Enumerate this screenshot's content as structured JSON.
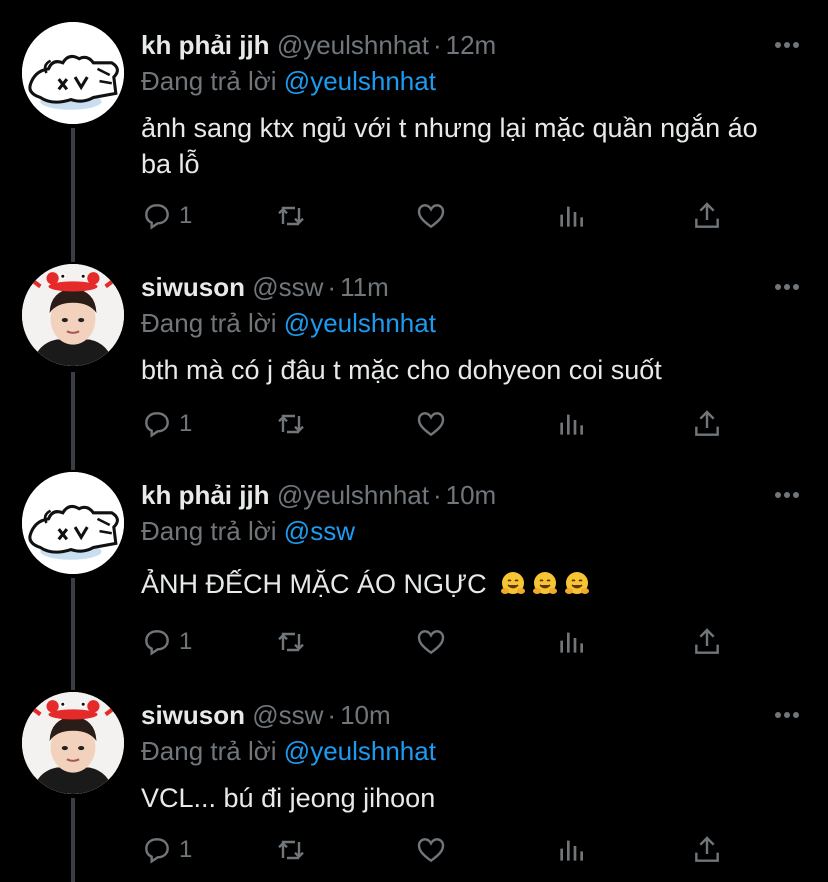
{
  "tweets": [
    {
      "display_name": "kh phải jjh",
      "handle": "@yeulshnhat",
      "time": "12m",
      "reply_prefix": "Đang trả lời",
      "reply_to": "@yeulshnhat",
      "text": "ảnh sang ktx ngủ với t nhưng lại mặc quần ngắn áo ba lỗ",
      "reply_count": "1",
      "avatar": "drawn-creature-avatar"
    },
    {
      "display_name": "siwuson",
      "handle": "@ssw",
      "time": "11m",
      "reply_prefix": "Đang trả lời",
      "reply_to": "@yeulshnhat",
      "text": "bth mà có j đâu t mặc cho dohyeon coi suốt",
      "reply_count": "1",
      "avatar": "person-with-crab-headband-avatar"
    },
    {
      "display_name": "kh phải jjh",
      "handle": "@yeulshnhat",
      "time": "10m",
      "reply_prefix": "Đang trả lời",
      "reply_to": "@ssw",
      "text": "ẢNH ĐẾCH MẶC ÁO NGỰC",
      "emoji": [
        "hugging-face-emoji",
        "hugging-face-emoji",
        "hugging-face-emoji"
      ],
      "reply_count": "1",
      "avatar": "drawn-creature-avatar"
    },
    {
      "display_name": "siwuson",
      "handle": "@ssw",
      "time": "10m",
      "reply_prefix": "Đang trả lời",
      "reply_to": "@yeulshnhat",
      "text": "VCL... bú đi jeong jihoon",
      "reply_count": "1",
      "avatar": "person-with-crab-headband-avatar"
    }
  ],
  "separator": "·",
  "colors": {
    "background": "#000000",
    "text": "#e7e9ea",
    "muted": "#71767b",
    "link": "#1d9bf0",
    "thread_line": "#3a3d41"
  }
}
